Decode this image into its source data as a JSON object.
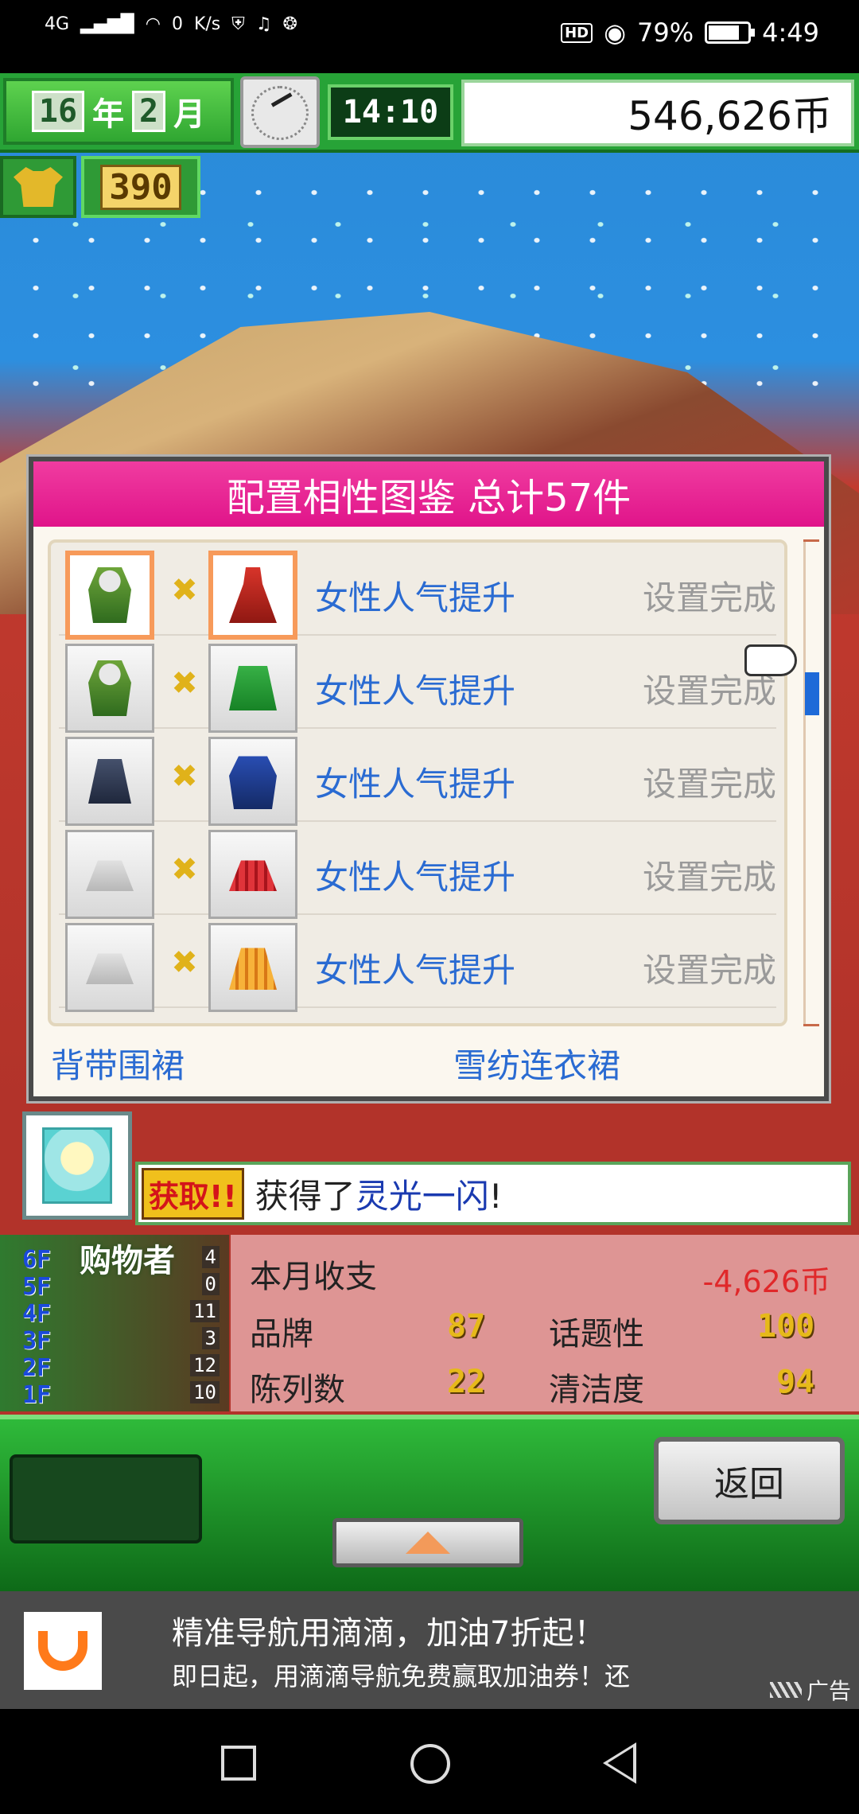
{
  "status_bar": {
    "network": "4G",
    "speed_value": "0",
    "speed_unit": "K/s",
    "hd": "HD",
    "battery_percent": "79%",
    "battery_level": 0.79,
    "time": "4:49"
  },
  "hud": {
    "year_value": "16",
    "year_label": "年",
    "month_value": "2",
    "month_label": "月",
    "clock_time": "14:10",
    "money": "546,626币",
    "points": "390"
  },
  "dialog": {
    "title": "配置相性图鉴 总计57件",
    "rows": [
      {
        "label": "女性人气提升",
        "status": "设置完成",
        "item_a": "green-vest-icon",
        "item_b": "red-dress-icon",
        "highlighted": true
      },
      {
        "label": "女性人气提升",
        "status": "设置完成",
        "item_a": "green-vest-icon",
        "item_b": "green-skirt-icon",
        "highlighted": false
      },
      {
        "label": "女性人气提升",
        "status": "设置完成",
        "item_a": "dark-skirt-icon",
        "item_b": "blue-jacket-icon",
        "highlighted": false
      },
      {
        "label": "女性人气提升",
        "status": "设置完成",
        "item_a": "white-skirt-icon",
        "item_b": "red-skirt-icon",
        "highlighted": false
      },
      {
        "label": "女性人气提升",
        "status": "设置完成",
        "item_a": "white-skirt-icon",
        "item_b": "orange-skirt-icon",
        "highlighted": false
      }
    ],
    "footer_left": "背带围裙",
    "footer_right": "雪纺连衣裙",
    "scroll_position": 0.3
  },
  "notification": {
    "tag": "获取!!",
    "text_prefix": "获得了",
    "text_highlight": "灵光一闪",
    "text_suffix": "!"
  },
  "floors": {
    "label": "购物者",
    "items": [
      {
        "floor": "6F",
        "count": "4"
      },
      {
        "floor": "5F",
        "count": "0"
      },
      {
        "floor": "4F",
        "count": "11"
      },
      {
        "floor": "3F",
        "count": "3"
      },
      {
        "floor": "2F",
        "count": "12"
      },
      {
        "floor": "1F",
        "count": "10"
      }
    ]
  },
  "stats": {
    "monthly_label": "本月收支",
    "monthly_value": "-4,626币",
    "brand_label": "品牌",
    "brand_value": "87",
    "topic_label": "话题性",
    "topic_value": "100",
    "display_label": "陈列数",
    "display_value": "22",
    "clean_label": "清洁度",
    "clean_value": "94"
  },
  "controls": {
    "return_label": "返回"
  },
  "ad": {
    "title": "精准导航用滴滴，加油7折起！",
    "subtitle": "即日起，用滴滴导航免费赢取加油券！还",
    "tag": "广告"
  },
  "colors": {
    "title_pink": "#e0148a",
    "label_blue": "#2a6bd2",
    "negative_red": "#e0282a",
    "stat_gold": "#e6b91a"
  }
}
